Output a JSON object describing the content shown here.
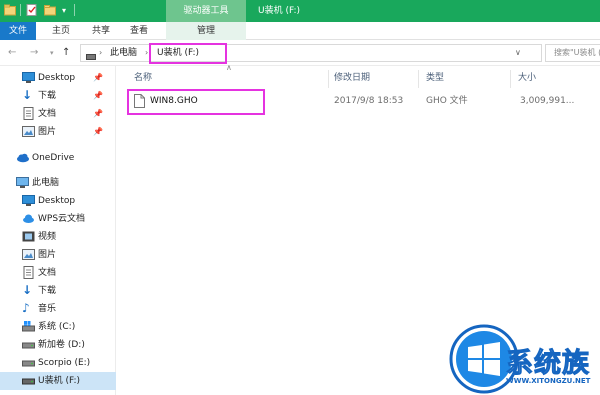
{
  "titlebar": {
    "context_tab": "驱动器工具",
    "window_title": "U装机 (F:)"
  },
  "ribbon": {
    "tabs": [
      "文件",
      "主页",
      "共享",
      "查看",
      "管理"
    ]
  },
  "address": {
    "crumbs": [
      "此电脑",
      "U装机 (F:)"
    ],
    "search_placeholder": "搜索\"U装机 (F:)\""
  },
  "sidebar": {
    "items": [
      {
        "label": "Desktop",
        "icon": "desktop-folder-icon",
        "pinned": true
      },
      {
        "label": "下载",
        "icon": "download-arrow-icon",
        "pinned": true
      },
      {
        "label": "文档",
        "icon": "document-icon",
        "pinned": true
      },
      {
        "label": "图片",
        "icon": "picture-icon",
        "pinned": true
      },
      {
        "label": "OneDrive",
        "icon": "cloud-icon"
      },
      {
        "label": "此电脑",
        "icon": "computer-icon"
      },
      {
        "label": "Desktop",
        "icon": "desktop-folder-icon"
      },
      {
        "label": "WPS云文档",
        "icon": "wps-cloud-icon"
      },
      {
        "label": "视频",
        "icon": "video-icon"
      },
      {
        "label": "图片",
        "icon": "picture-icon"
      },
      {
        "label": "文档",
        "icon": "document-icon"
      },
      {
        "label": "下载",
        "icon": "download-arrow-icon"
      },
      {
        "label": "音乐",
        "icon": "music-note-icon"
      },
      {
        "label": "系统 (C:)",
        "icon": "windows-drive-icon"
      },
      {
        "label": "新加卷 (D:)",
        "icon": "drive-icon"
      },
      {
        "label": "Scorpio (E:)",
        "icon": "drive-icon"
      },
      {
        "label": "U装机 (F:)",
        "icon": "usb-drive-icon",
        "selected": true
      }
    ]
  },
  "columns": [
    "名称",
    "修改日期",
    "类型",
    "大小"
  ],
  "files": [
    {
      "name": "WIN8.GHO",
      "modified": "2017/9/8 18:53",
      "type": "GHO 文件",
      "size": "3,009,991..."
    }
  ],
  "watermark": {
    "brand": "系统族",
    "url": "WWW.XITONGZU.NET"
  },
  "colors": {
    "titlebar": "#19a85c",
    "file_tab": "#1979ca",
    "highlight": "#e533e0",
    "selected_nav": "#cce4f7"
  }
}
